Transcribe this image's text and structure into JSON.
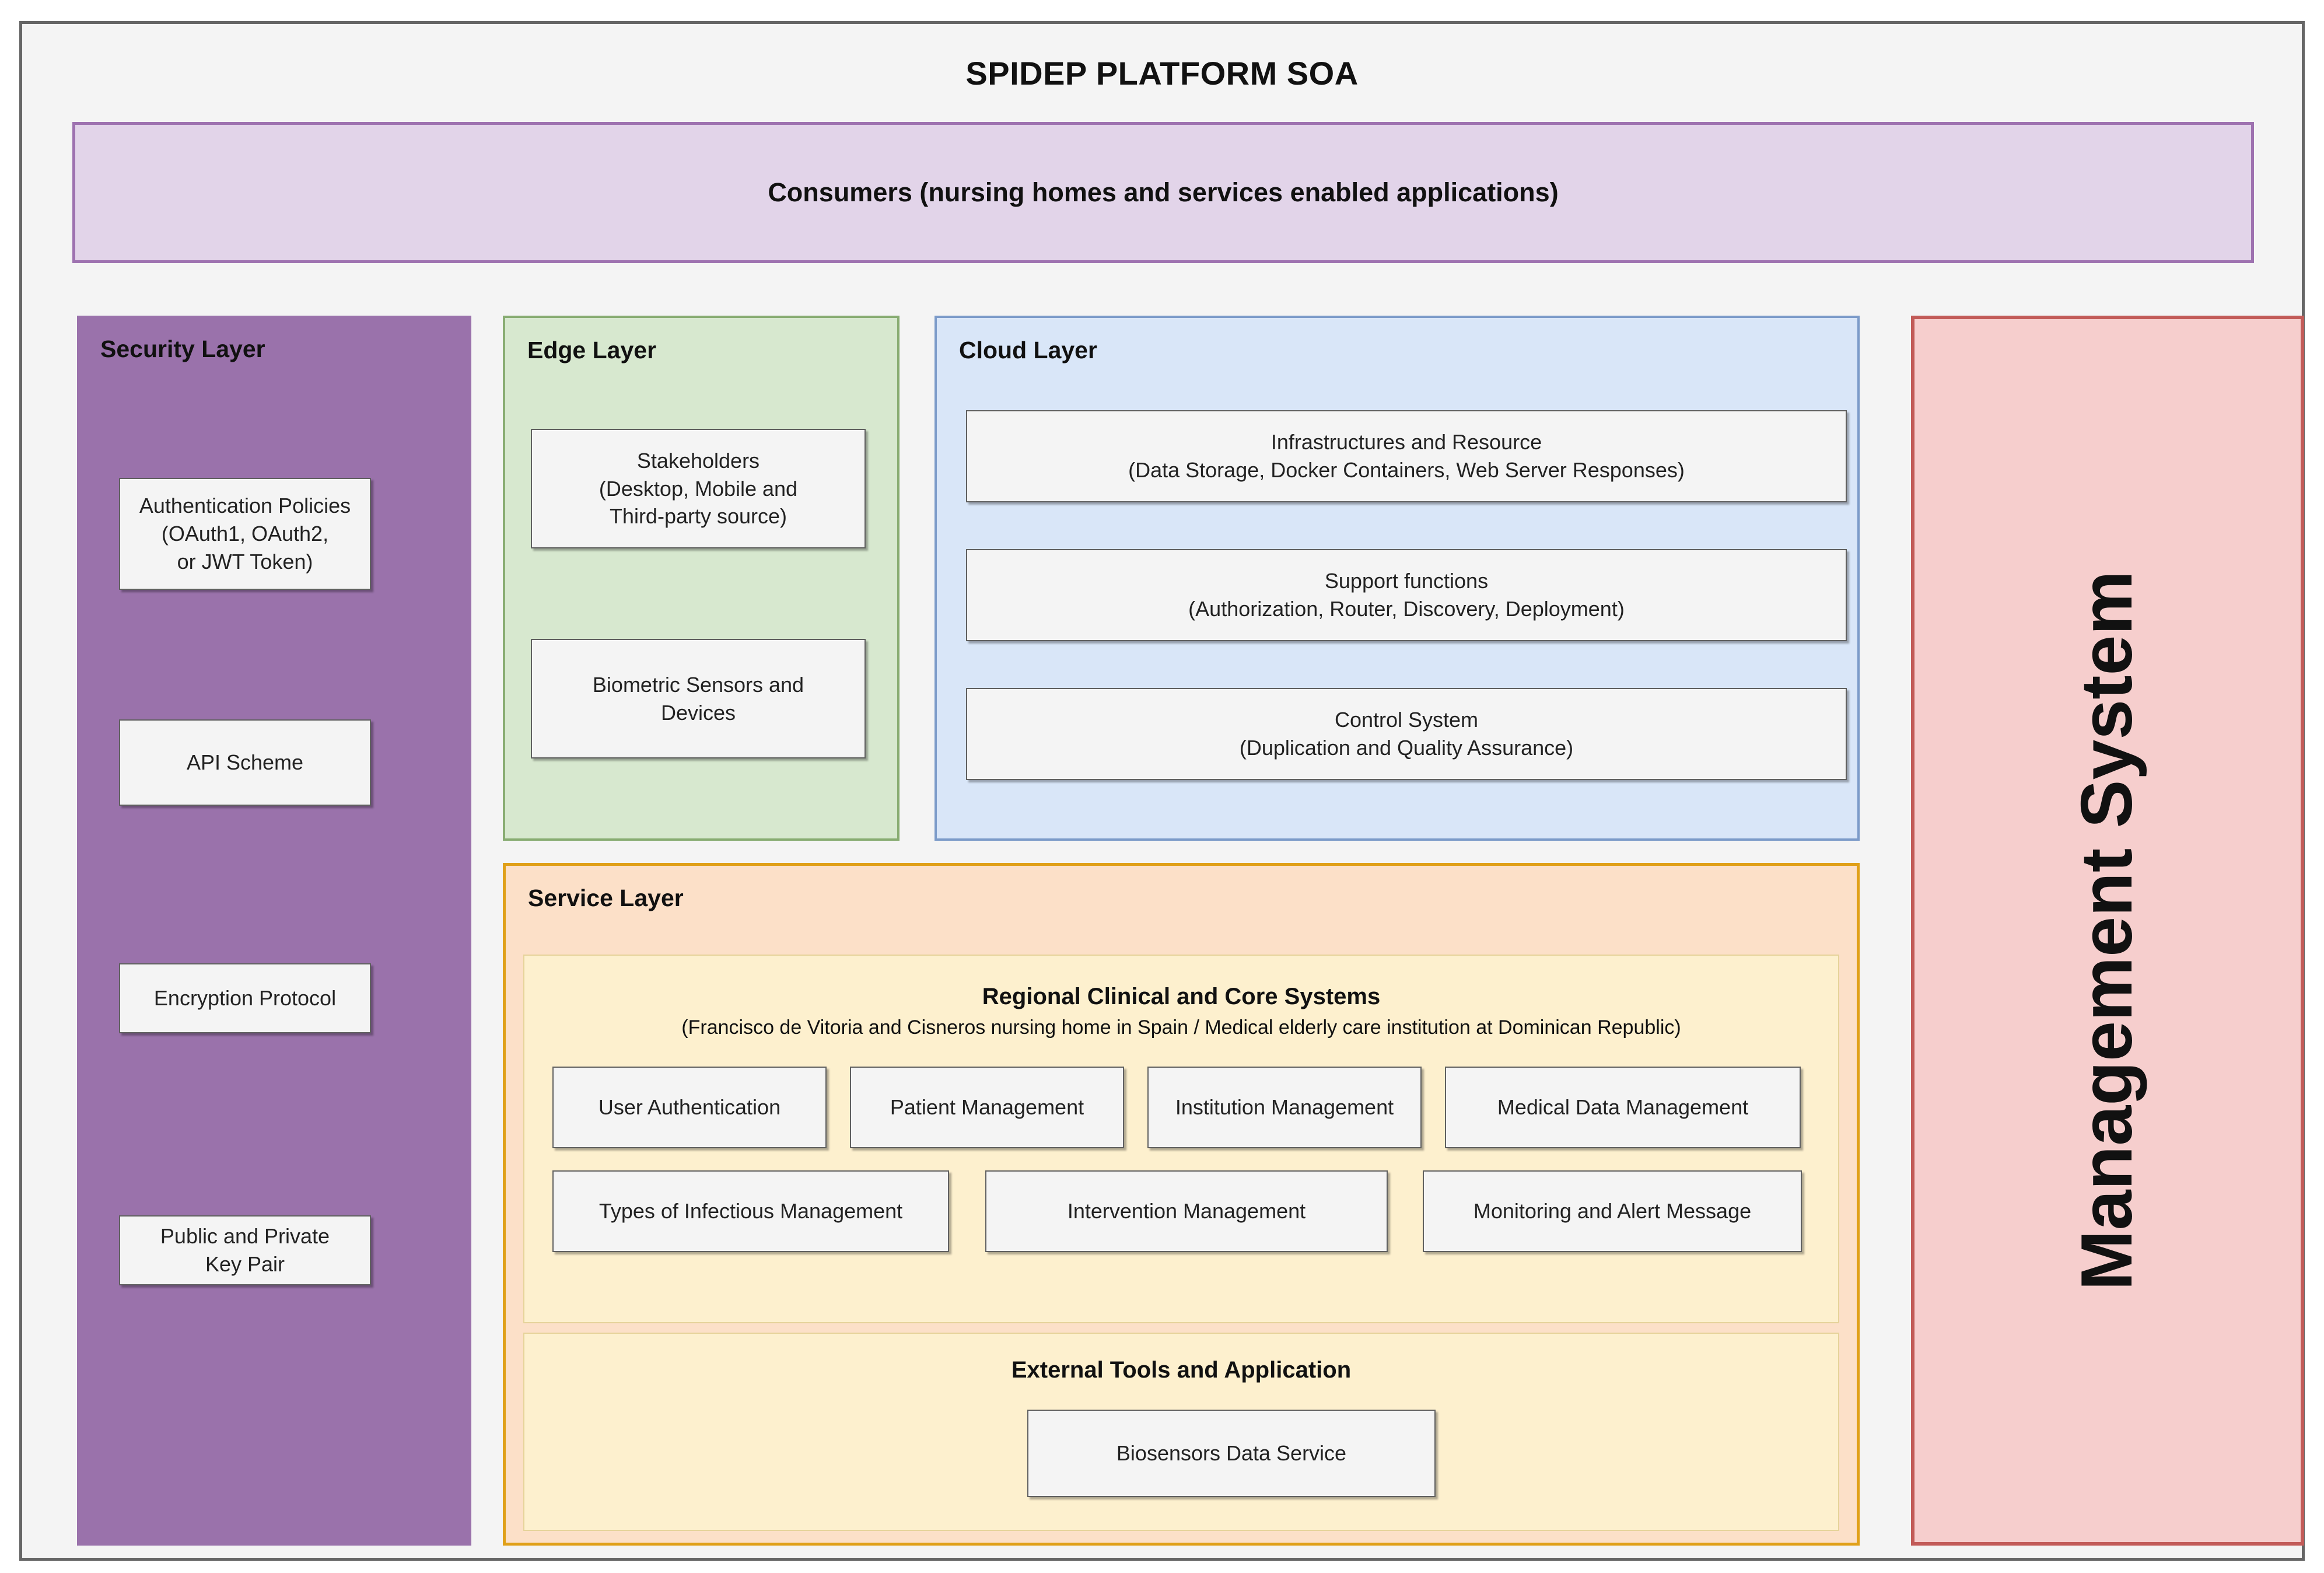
{
  "title": "SPIDEP PLATFORM SOA",
  "consumers": {
    "label": "Consumers (nursing homes and services enabled\napplications)"
  },
  "security_layer": {
    "title": "Security Layer",
    "color": "#9a72ab",
    "nodes": [
      {
        "label": "Authentication Policies\n(OAuth1, OAuth2,\nor JWT Token)"
      },
      {
        "label": "API Scheme"
      },
      {
        "label": "Encryption Protocol"
      },
      {
        "label": "Public and Private\nKey Pair"
      }
    ]
  },
  "edge_layer": {
    "title": "Edge Layer",
    "color": "#d7e8cf",
    "nodes": [
      {
        "label": "Stakeholders\n(Desktop, Mobile and\nThird-party source)"
      },
      {
        "label": "Biometric Sensors and\nDevices"
      }
    ]
  },
  "cloud_layer": {
    "title": "Cloud Layer",
    "color": "#d9e6f8",
    "nodes": [
      {
        "label": "Infrastructures and Resource\n(Data Storage, Docker Containers, Web Server Responses)"
      },
      {
        "label": "Support functions\n(Authorization, Router, Discovery, Deployment)"
      },
      {
        "label": "Control System\n(Duplication and Quality Assurance)"
      }
    ]
  },
  "service_layer": {
    "title": "Service Layer",
    "color": "#fce0c8",
    "core_systems": {
      "title": "Regional Clinical and Core Systems",
      "subtitle": "(Francisco de Vitoria and Cisneros nursing home in Spain / Medical elderly care institution at Dominican Republic)",
      "row1": [
        {
          "label": "User Authentication"
        },
        {
          "label": "Patient Management"
        },
        {
          "label": "Institution Management"
        },
        {
          "label": "Medical Data Management"
        }
      ],
      "row2": [
        {
          "label": "Types of Infectious Management"
        },
        {
          "label": "Intervention Management"
        },
        {
          "label": "Monitoring and Alert Message"
        }
      ]
    },
    "external_tools": {
      "title": "External Tools and Application",
      "nodes": [
        {
          "label": "Biosensors Data Service"
        }
      ]
    }
  },
  "management_system": {
    "label": "Management\nSystem",
    "color": "#f6cecd"
  }
}
